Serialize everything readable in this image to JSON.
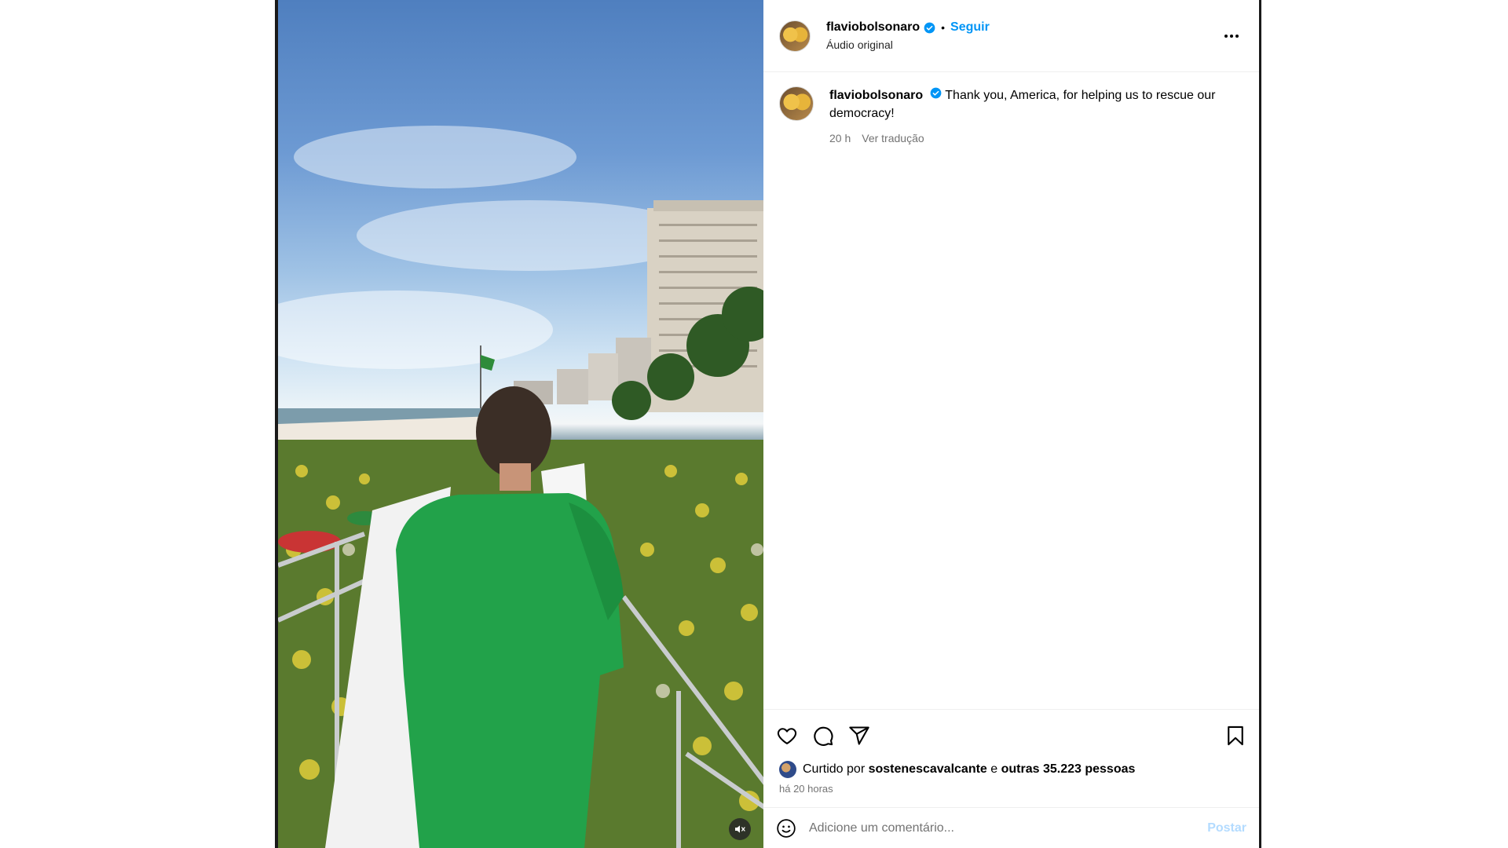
{
  "post": {
    "author": {
      "username": "flaviobolsonaro",
      "verified": true,
      "avatar_icon": "profile-avatar"
    },
    "follow_label": "Seguir",
    "separator": "•",
    "audio_label": "Áudio original",
    "caption": {
      "username": "flaviobolsonaro",
      "text": "Thank you, America, for helping us to rescue our democracy!",
      "age": "20 h",
      "translate_label": "Ver tradução"
    },
    "actions": {
      "like_icon": "heart-icon",
      "comment_icon": "comment-icon",
      "share_icon": "share-icon",
      "save_icon": "bookmark-icon"
    },
    "likes": {
      "prefix": "Curtido por",
      "liker": "sostenescavalcante",
      "connector": "e",
      "others": "outras 35.223 pessoas"
    },
    "timestamp": "há 20 horas",
    "comment": {
      "placeholder": "Adicione um comentário...",
      "post_label": "Postar"
    },
    "media": {
      "mute_icon": "muted-speaker-icon"
    }
  },
  "colors": {
    "accent": "#0095f6",
    "verified_badge": "#0095f6",
    "post_button_disabled": "#b3dbff",
    "secondary_text": "#737373"
  }
}
